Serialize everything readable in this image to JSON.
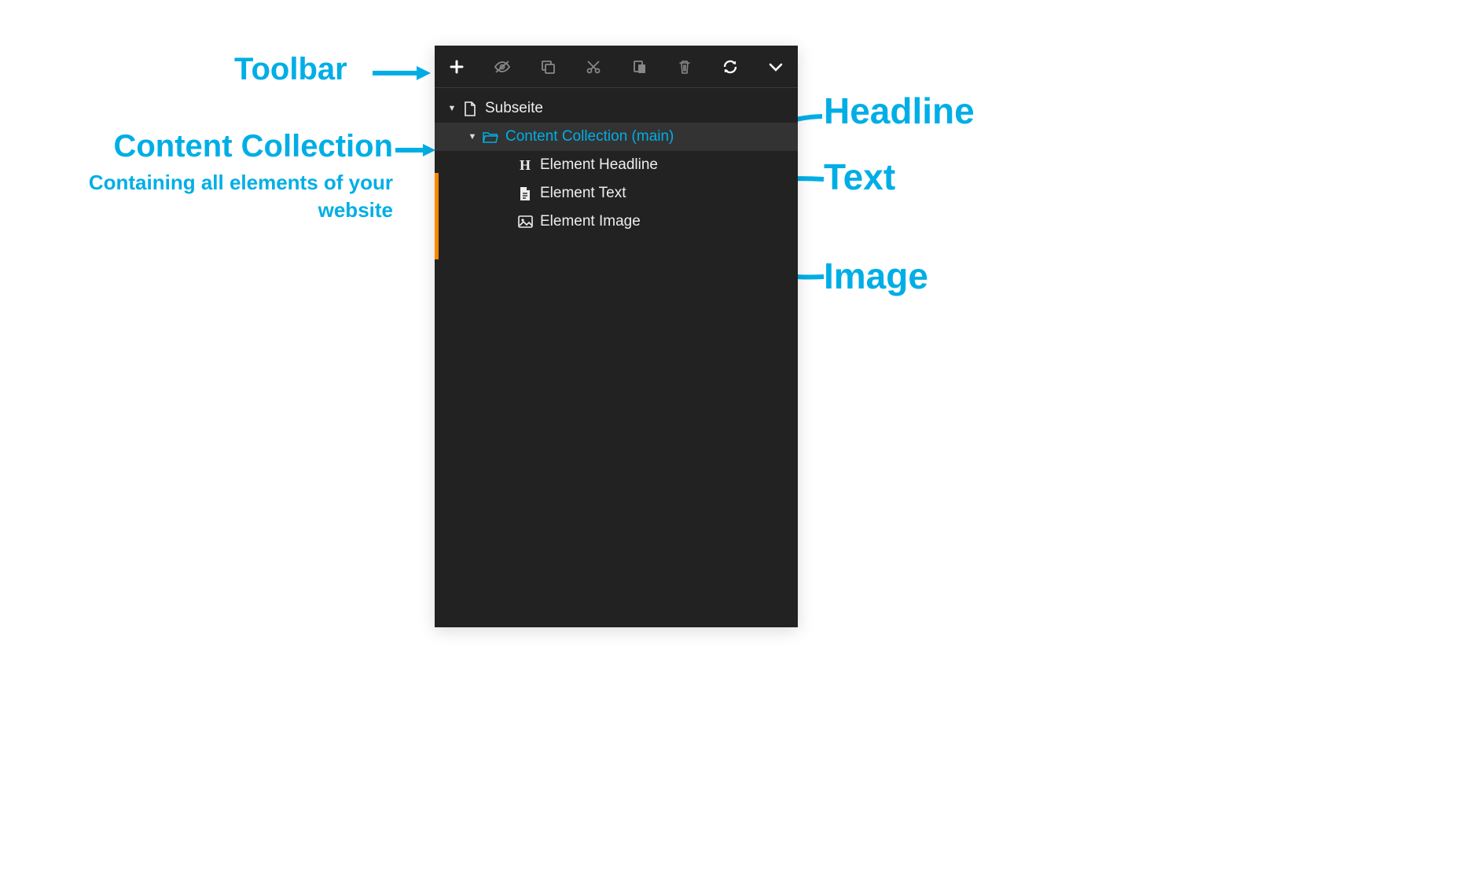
{
  "annotations": {
    "toolbar": "Toolbar",
    "content_collection": "Content Collection",
    "content_collection_sub": "Containing all elements of your website",
    "headline": "Headline",
    "text": "Text",
    "image": "Image"
  },
  "toolbar": {
    "items": [
      {
        "name": "add-icon",
        "active": true
      },
      {
        "name": "hide-icon",
        "active": false
      },
      {
        "name": "copy-icon",
        "active": false
      },
      {
        "name": "cut-icon",
        "active": false
      },
      {
        "name": "paste-icon",
        "active": false
      },
      {
        "name": "delete-icon",
        "active": false
      },
      {
        "name": "refresh-icon",
        "active": true
      },
      {
        "name": "chevron-down-icon",
        "active": true
      }
    ]
  },
  "tree": {
    "root": {
      "label": "Subseite",
      "children": [
        {
          "label": "Content Collection (main)",
          "selected": true,
          "children": [
            {
              "label": "Element Headline",
              "icon": "heading"
            },
            {
              "label": "Element Text",
              "icon": "file-text"
            },
            {
              "label": "Element Image",
              "icon": "image"
            }
          ]
        }
      ]
    }
  },
  "colors": {
    "accent": "#00aee6",
    "panel_bg": "#222222",
    "orange": "#ff8700"
  }
}
